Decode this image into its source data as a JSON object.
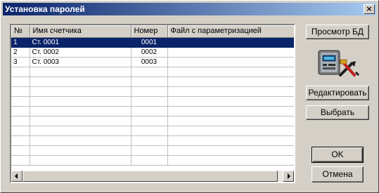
{
  "window": {
    "title": "Установка паролей",
    "close_glyph": "×"
  },
  "table": {
    "columns": [
      "№",
      "Имя счетчика",
      "Номер",
      "Файл с параметризацией"
    ],
    "rows": [
      {
        "num": "1",
        "name": "Ст. 0001",
        "number": "0001",
        "file": ""
      },
      {
        "num": "2",
        "name": "Ст. 0002",
        "number": "0002",
        "file": ""
      },
      {
        "num": "3",
        "name": "Ст. 0003",
        "number": "0003",
        "file": ""
      }
    ],
    "selected_row": 1
  },
  "buttons": {
    "view_db": "Просмотр БД",
    "edit": "Редактировать",
    "select": "Выбрать",
    "ok": "OK",
    "cancel": "Отмена"
  },
  "icons": {
    "meter": "electric-meter-with-tools-icon"
  },
  "colors": {
    "title_bar": "#0a246a",
    "selection": "#0a246a",
    "face": "#d4d0c8"
  }
}
